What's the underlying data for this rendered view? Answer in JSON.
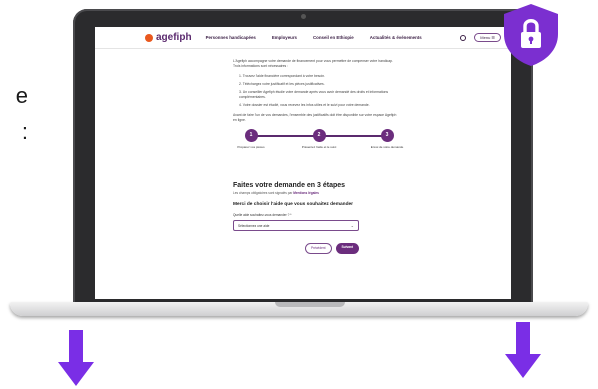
{
  "slide": {
    "edge_text": [
      "e",
      ":"
    ]
  },
  "site": {
    "logo": "agefiph",
    "nav": [
      "Personnes handicapées",
      "Employeurs",
      "Conseil en Ethiopie",
      "Actualités & événements"
    ],
    "menu_label": "Menu ☰"
  },
  "page": {
    "intro": "L'Agefiph accompagne votre demande de financement pour vous permettre de compenser votre handicap. Trois informations sont nécessaires :",
    "list": [
      "1. Trouvez l'aide financière correspondant à votre besoin.",
      "2. Téléchargez votre justificatif et les pièces justificatives.",
      "3. Un conseiller Agefiph étudie votre demande après vous avoir demandé des droits et informations complémentaires.",
      "4. Votre dossier est étudié, vous recevez les infos utiles et le suivi pour votre demande."
    ],
    "note": "Avant de faire l'un de vos demandes, l'ensemble des justificatifs doit être disponible sur votre espace Agefiph en ligne.",
    "steps": [
      {
        "num": "1",
        "label": "Préparez vos pièces"
      },
      {
        "num": "2",
        "label": "Présentez l'aide et le suivi"
      },
      {
        "num": "3",
        "label": "Envoi de votre demande"
      }
    ],
    "form_title": "Faites votre demande en 3 étapes",
    "form_sub": "Les champs obligatoires sont signalés par",
    "form_sub_link": "Mentions légales",
    "form_question": "Merci de choisir l'aide que vous souhaitez demander",
    "select_label": "Quelle aide souhaitez-vous demander ? *",
    "select_value": "Sélectionnez une aide",
    "btn_prev": "Précédent",
    "btn_next": "Suivant"
  },
  "colors": {
    "brand_purple": "#6b2d7d",
    "logo_orange": "#e9581e",
    "shield_purple": "#7b2fd0",
    "arrow_purple": "#7a2ee6"
  },
  "icons": {
    "shield": "shield-lock-icon",
    "arrows": [
      "arrow-down-icon",
      "arrow-down-icon"
    ]
  }
}
